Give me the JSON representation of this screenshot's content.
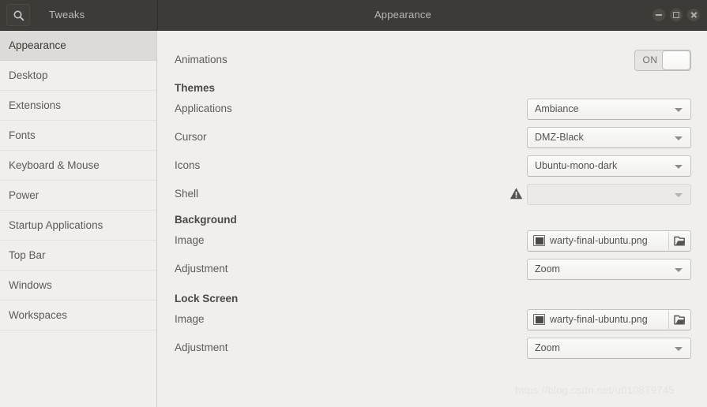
{
  "titlebar": {
    "search_icon": "search-icon",
    "app_title": "Tweaks",
    "window_title": "Appearance",
    "controls": {
      "minimize": "minimize-icon",
      "maximize": "maximize-icon",
      "close": "close-icon"
    }
  },
  "sidebar": {
    "items": [
      {
        "label": "Appearance",
        "selected": true
      },
      {
        "label": "Desktop",
        "selected": false
      },
      {
        "label": "Extensions",
        "selected": false
      },
      {
        "label": "Fonts",
        "selected": false
      },
      {
        "label": "Keyboard & Mouse",
        "selected": false
      },
      {
        "label": "Power",
        "selected": false
      },
      {
        "label": "Startup Applications",
        "selected": false
      },
      {
        "label": "Top Bar",
        "selected": false
      },
      {
        "label": "Windows",
        "selected": false
      },
      {
        "label": "Workspaces",
        "selected": false
      }
    ]
  },
  "content": {
    "animations": {
      "label": "Animations",
      "toggle_state": "ON"
    },
    "themes": {
      "section_label": "Themes",
      "applications": {
        "label": "Applications",
        "value": "Ambiance"
      },
      "cursor": {
        "label": "Cursor",
        "value": "DMZ-Black"
      },
      "icons": {
        "label": "Icons",
        "value": "Ubuntu-mono-dark"
      },
      "shell": {
        "label": "Shell",
        "value": "",
        "warning_icon": "warning-icon",
        "disabled": true
      }
    },
    "background": {
      "section_label": "Background",
      "image": {
        "label": "Image",
        "value": "warty-final-ubuntu.png"
      },
      "adjustment": {
        "label": "Adjustment",
        "value": "Zoom"
      }
    },
    "lock_screen": {
      "section_label": "Lock Screen",
      "image": {
        "label": "Image",
        "value": "warty-final-ubuntu.png"
      },
      "adjustment": {
        "label": "Adjustment",
        "value": "Zoom"
      }
    }
  },
  "watermark": {
    "text": "https://blog.csdn.net/u010879745"
  },
  "colors": {
    "titlebar_bg": "#3c3b37",
    "sidebar_bg": "#f0efed",
    "sidebar_selected_bg": "#dcdbd7",
    "content_bg": "#f0efed",
    "text": "#5d5c58"
  }
}
